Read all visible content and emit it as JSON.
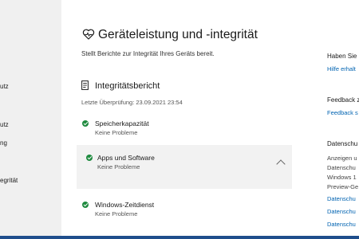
{
  "sidebar": {
    "items": [
      {
        "label": "utz"
      },
      {
        "label": "utz"
      },
      {
        "label": "ng"
      },
      {
        "label": "egrität"
      }
    ]
  },
  "main": {
    "title": "Geräteleistung und -integrität",
    "subtitle": "Stellt Berichte zur Integrität Ihres Geräts bereit.",
    "report": {
      "title": "Integritätsbericht",
      "last_check": "Letzte Überprüfung: 23.09.2021 23:54",
      "items": [
        {
          "title": "Speicherkapazität",
          "status": "Keine Probleme",
          "expanded": false
        },
        {
          "title": "Apps und Software",
          "status": "Keine Probleme",
          "expanded": true
        },
        {
          "title": "Windows-Zeitdienst",
          "status": "Keine Probleme",
          "expanded": false
        }
      ]
    }
  },
  "right": {
    "help_head": "Haben Sie",
    "help_link": "Hilfe erhalt",
    "feedback_head": "Feedback z",
    "feedback_link": "Feedback s",
    "privacy_head": "Datenschu",
    "privacy_lines": [
      "Anzeigen u",
      "Datenschu",
      "Windows 1",
      "Preview-Ge"
    ],
    "privacy_links": [
      "Datenschu",
      "Datenschu",
      "Datenschu"
    ]
  },
  "colors": {
    "accent_link": "#0063b1",
    "status_ok": "#1e8a3e",
    "sidebar_bg": "#f0f0f0"
  }
}
